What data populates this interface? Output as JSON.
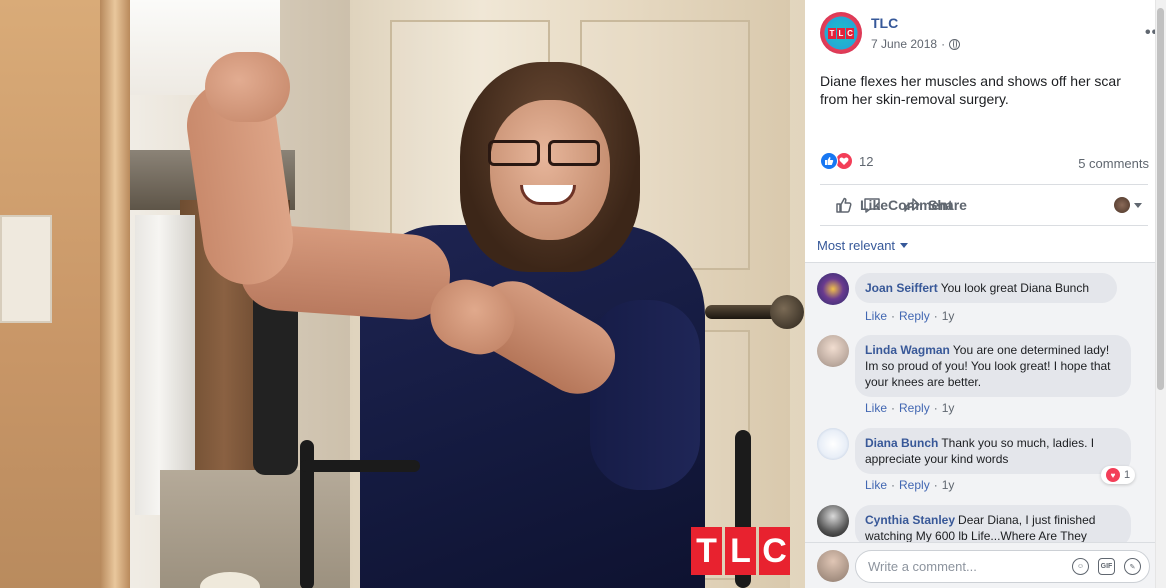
{
  "post": {
    "page_name": "TLC",
    "date": "7 June 2018",
    "separator": "·",
    "more": "•••",
    "caption": "Diane flexes her muscles and shows off her scar from her skin-removal surgery.",
    "reactions_count": "12",
    "comments_count": "5 comments"
  },
  "actions": {
    "like": "Like",
    "comment": "Comment",
    "share": "Share"
  },
  "sort": {
    "label": "Most relevant"
  },
  "comments": [
    {
      "name": "Joan Seiffert",
      "text": "You look great Diana Bunch",
      "like": "Like",
      "reply": "Reply",
      "time": "1y"
    },
    {
      "name": "Linda Wagman",
      "text": "You are one determined lady! Im so proud of you! You look great! I hope that your knees are better.",
      "like": "Like",
      "reply": "Reply",
      "time": "1y"
    },
    {
      "name": "Diana Bunch",
      "text": "Thank you so much, ladies. I appreciate your kind words",
      "like": "Like",
      "reply": "Reply",
      "time": "1y",
      "reaction_count": "1"
    },
    {
      "name": "Cynthia Stanley",
      "text": "Dear Diana, I just finished watching My 600 lb Life...Where Are They"
    }
  ],
  "composer": {
    "placeholder": "Write a comment..."
  },
  "watermark": {
    "letters": [
      "T",
      "L",
      "C"
    ]
  },
  "colors": {
    "link": "#365899",
    "brand_red": "#e8222f",
    "like_blue": "#1877f2",
    "love_red": "#f33e58"
  }
}
